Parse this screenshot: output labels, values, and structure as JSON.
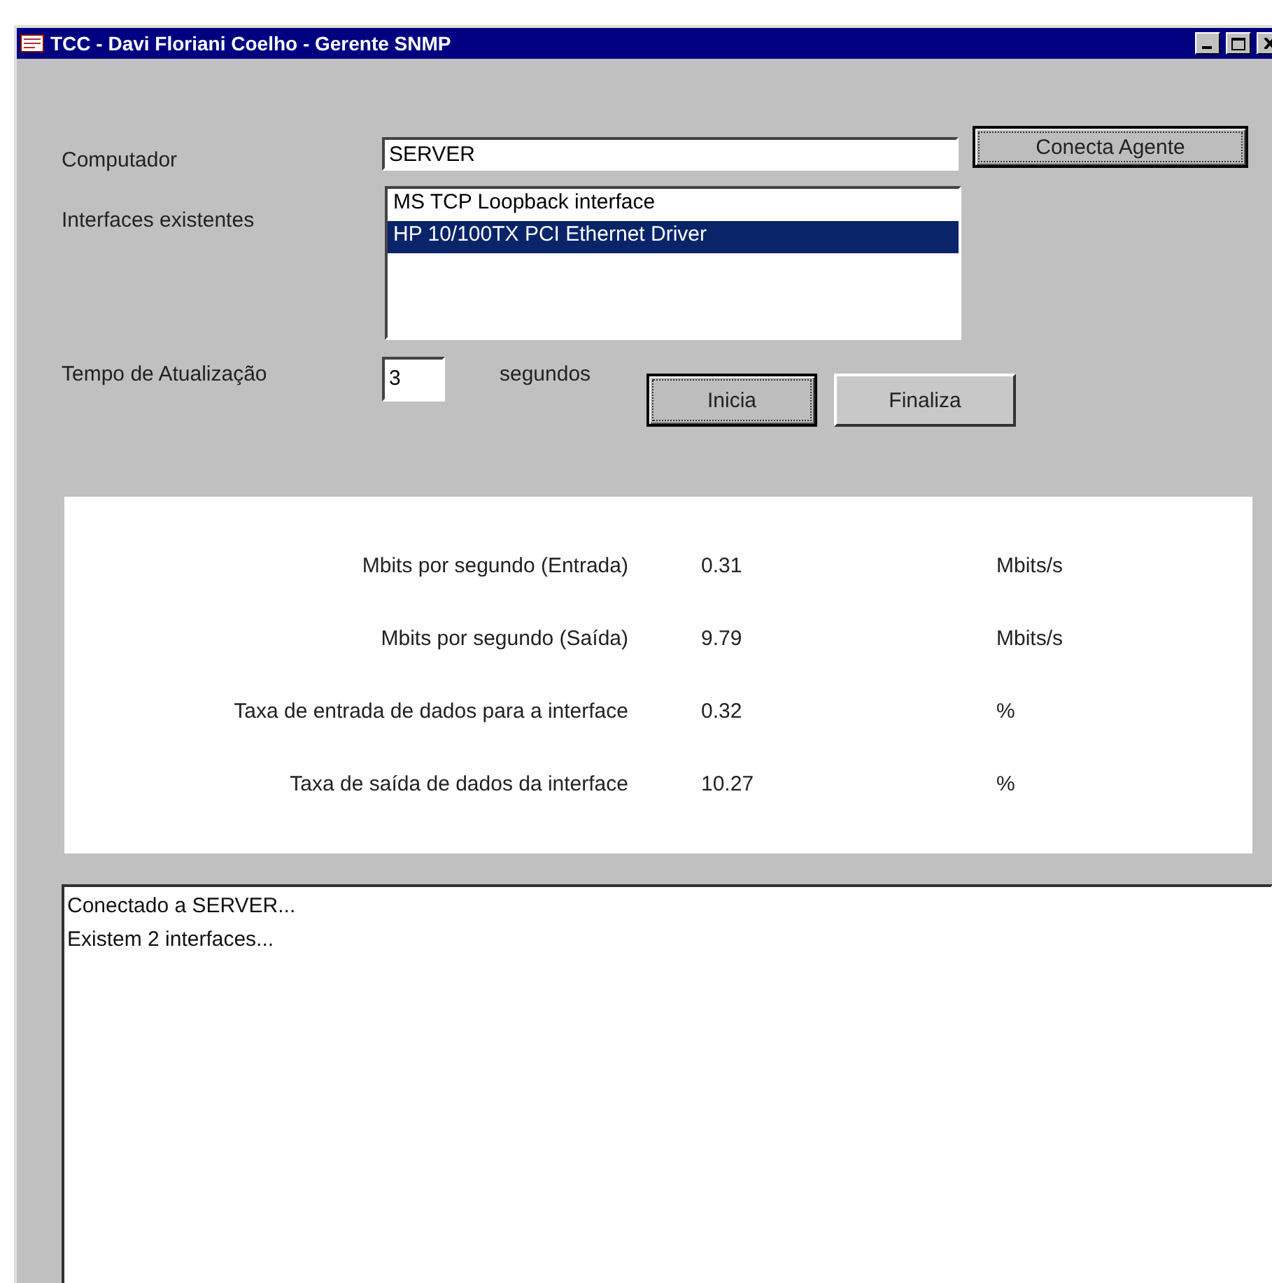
{
  "window": {
    "title": "TCC - Davi Floriani Coelho - Gerente SNMP"
  },
  "computer": {
    "label": "Computador",
    "value": "SERVER",
    "button": "Conecta Agente"
  },
  "interfaces": {
    "label": "Interfaces existentes",
    "items": [
      {
        "name": "MS TCP Loopback interface",
        "selected": false
      },
      {
        "name": "HP 10/100TX PCI Ethernet Driver",
        "selected": true
      }
    ]
  },
  "refresh": {
    "label": "Tempo de Atualização",
    "value": "3",
    "unit": "segundos",
    "buttons": [
      {
        "label": "Inicia",
        "focused": true
      },
      {
        "label": "Finaliza",
        "focused": false
      }
    ]
  },
  "stats": [
    {
      "label": "Mbits por segundo (Entrada)",
      "value": "0.31",
      "unit": "Mbits/s"
    },
    {
      "label": "Mbits por segundo (Saída)",
      "value": "9.79",
      "unit": "Mbits/s"
    },
    {
      "label": "Taxa de entrada de dados para a interface",
      "value": "0.32",
      "unit": "%"
    },
    {
      "label": "Taxa de saída de dados da interface",
      "value": "10.27",
      "unit": "%"
    }
  ],
  "log": [
    "Conectado a SERVER...",
    "Existem 2 interfaces..."
  ]
}
